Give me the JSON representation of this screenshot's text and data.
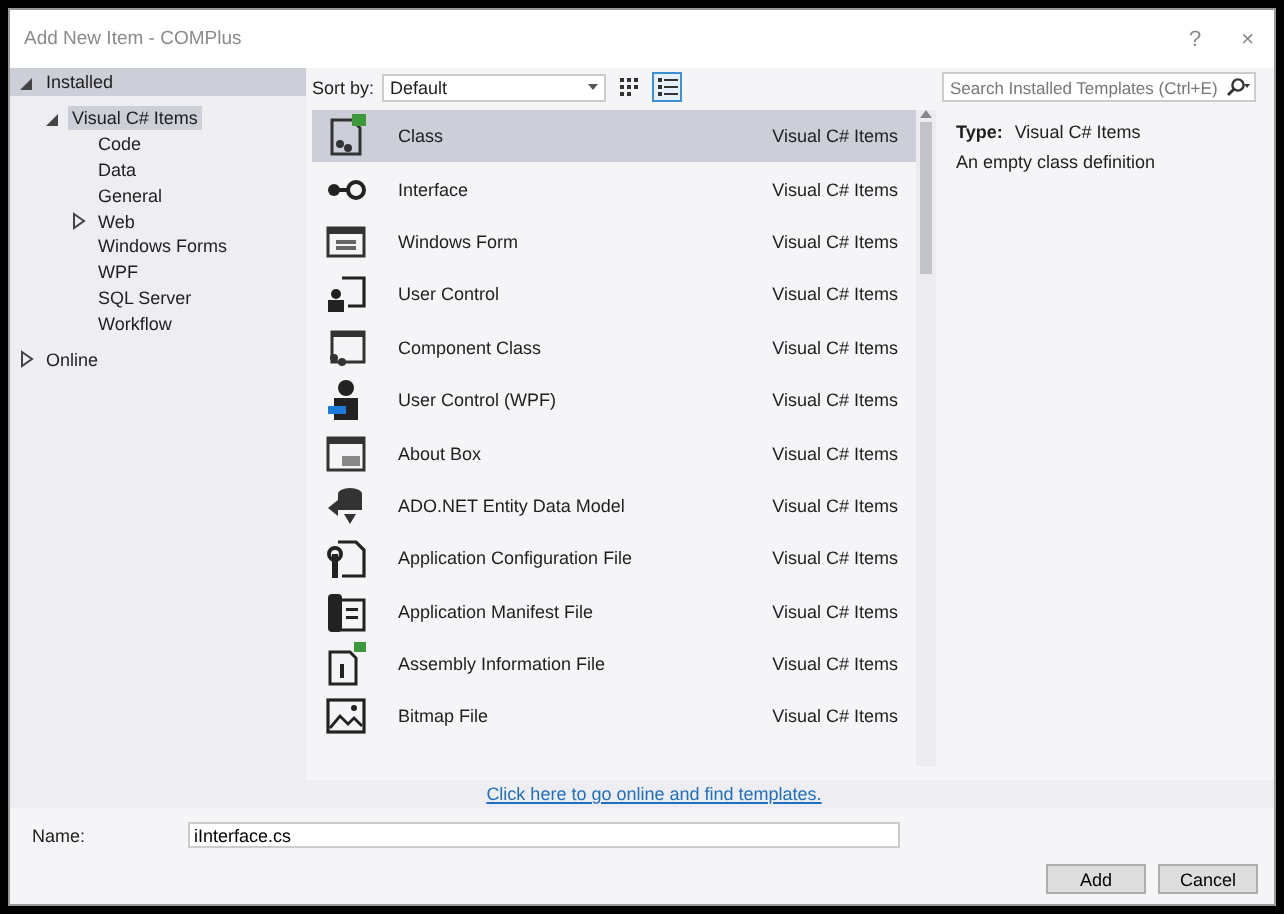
{
  "window": {
    "title": "Add New Item - COMPlus",
    "help": "?",
    "close": "×"
  },
  "sidebar": {
    "items": [
      {
        "label": "Installed",
        "kind": "header",
        "expanded": true,
        "children": [
          {
            "label": "Visual C# Items",
            "expanded": true,
            "selected": true,
            "children": [
              {
                "label": "Code",
                "selected": false
              },
              {
                "label": "Data",
                "selected": false
              },
              {
                "label": "General",
                "selected": false
              },
              {
                "label": "Web",
                "selected": false,
                "expanded": false
              },
              {
                "label": "Windows Forms",
                "selected": false
              },
              {
                "label": "WPF",
                "selected": false
              },
              {
                "label": "SQL Server",
                "selected": false
              },
              {
                "label": "Workflow",
                "selected": false
              }
            ]
          }
        ]
      },
      {
        "label": "Online",
        "expanded": false,
        "selected": false
      }
    ]
  },
  "toolbar": {
    "sort_label": "Sort by:",
    "sort_value": "Default",
    "view_buttons": [
      {
        "kind": "grid",
        "selected": false
      },
      {
        "kind": "list",
        "selected": true
      }
    ]
  },
  "templates": [
    {
      "name": "Class",
      "category": "Visual C# Items",
      "kind": "class",
      "selected": true
    },
    {
      "name": "Interface",
      "category": "Visual C# Items",
      "kind": "interface",
      "selected": false
    },
    {
      "name": "Windows Form",
      "category": "Visual C# Items",
      "kind": "form",
      "selected": false
    },
    {
      "name": "User Control",
      "category": "Visual C# Items",
      "kind": "usercontrol",
      "selected": false
    },
    {
      "name": "Component Class",
      "category": "Visual C# Items",
      "kind": "component",
      "selected": false
    },
    {
      "name": "User Control (WPF)",
      "category": "Visual C# Items",
      "kind": "wpf",
      "selected": false
    },
    {
      "name": "About Box",
      "category": "Visual C# Items",
      "kind": "about",
      "selected": false
    },
    {
      "name": "ADO.NET Entity Data Model",
      "category": "Visual C# Items",
      "kind": "entity",
      "selected": false
    },
    {
      "name": "Application Configuration File",
      "category": "Visual C# Items",
      "kind": "config",
      "selected": false
    },
    {
      "name": "Application Manifest File",
      "category": "Visual C# Items",
      "kind": "manifest",
      "selected": false
    },
    {
      "name": "Assembly Information File",
      "category": "Visual C# Items",
      "kind": "assembly",
      "selected": false
    },
    {
      "name": "Bitmap File",
      "category": "Visual C# Items",
      "kind": "bitmap",
      "selected": false
    }
  ],
  "online_link": "Click here to go online and find templates.",
  "details": {
    "search_placeholder": "Search Installed Templates (Ctrl+E)",
    "type_label": "Type:",
    "type_value": "Visual C# Items",
    "description": "An empty class definition"
  },
  "name_field": {
    "label": "Name:",
    "value": "iInterface.cs"
  },
  "buttons": [
    "Add",
    "Cancel"
  ]
}
